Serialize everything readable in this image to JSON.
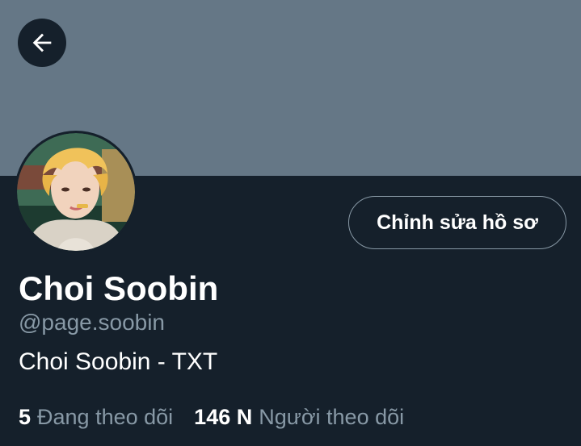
{
  "header": {
    "back_icon": "arrow-left-icon"
  },
  "profile": {
    "avatar_icon": "profile-photo",
    "edit_button_label": "Chỉnh sửa hồ sơ",
    "display_name": "Choi Soobin",
    "handle": "@page.soobin",
    "bio": "Choi Soobin - TXT"
  },
  "stats": {
    "following_count": "5",
    "following_label": "Đang theo dõi",
    "followers_count": "146 N",
    "followers_label": "Người theo dõi"
  },
  "colors": {
    "background": "#15202b",
    "banner": "#657786",
    "muted_text": "#8899a6",
    "primary_text": "#ffffff"
  }
}
